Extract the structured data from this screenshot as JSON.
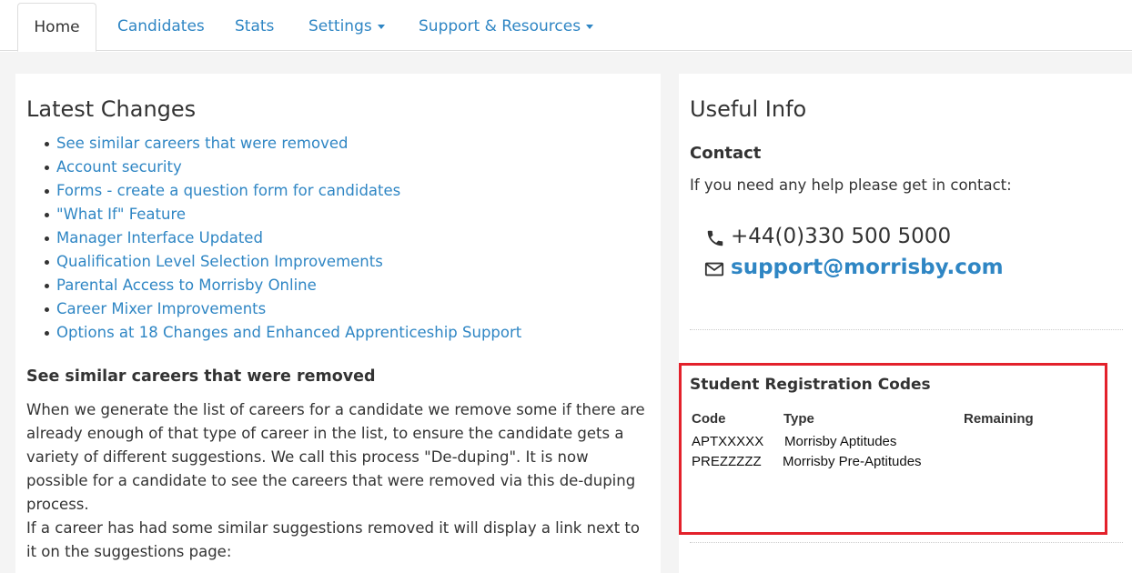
{
  "nav": {
    "tabs": [
      {
        "label": "Home",
        "active": true
      },
      {
        "label": "Candidates"
      },
      {
        "label": "Stats"
      },
      {
        "label": "Settings",
        "dropdown": true
      },
      {
        "label": "Support & Resources",
        "dropdown": true
      }
    ]
  },
  "latest": {
    "title": "Latest Changes",
    "items": [
      "See similar careers that were removed",
      "Account security",
      "Forms - create a question form for candidates",
      "\"What If\" Feature",
      "Manager Interface Updated",
      "Qualification Level Selection Improvements",
      "Parental Access to Morrisby Online",
      "Career Mixer Improvements",
      "Options at 18 Changes and Enhanced Apprenticeship Support"
    ],
    "section_title": "See similar careers that were removed",
    "para1": "When we generate the list of careers for a candidate we remove some if there are already enough of that type of career in the list, to ensure the candidate gets a variety of different suggestions. We call this process \"De-duping\". It is now possible for a candidate to see the careers that were removed via this de-duping process.",
    "para2": "If a career has had some similar suggestions removed it will display a link next to it on the suggestions page:"
  },
  "useful": {
    "title": "Useful Info",
    "contact_title": "Contact",
    "contact_text": "If you need any help please get in contact:",
    "phone": "+44(0)330 500 5000",
    "email": "support@morrisby.com",
    "phone_icon": "phone-icon",
    "email_icon": "envelope-icon"
  },
  "registration": {
    "title": "Student Registration Codes",
    "headers": {
      "code": "Code",
      "type": "Type",
      "remaining": "Remaining"
    },
    "rows": [
      {
        "code": "APTXXXXX",
        "type": "Morrisby Aptitudes",
        "remaining": ""
      },
      {
        "code": "PREZZZZZ",
        "type": "Morrisby Pre-Aptitudes",
        "remaining": ""
      }
    ]
  },
  "colors": {
    "link": "#2f86c4",
    "text": "#333333",
    "highlight_box": "#e3212b"
  }
}
